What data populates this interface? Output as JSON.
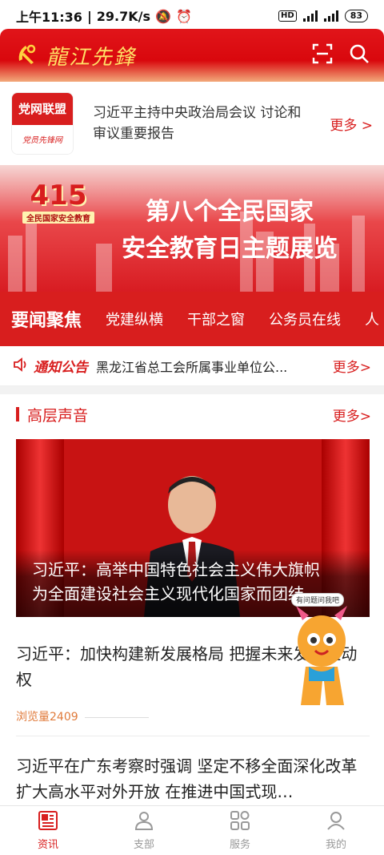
{
  "status_bar": {
    "time": "上午11:36",
    "net_speed": "29.7K/s",
    "network_hd": "HD",
    "network_4g_a": "4G",
    "network_4g_b": "4G",
    "battery": "83"
  },
  "header": {
    "app_title": "龍江先鋒",
    "icons": [
      "party-emblem-icon",
      "scan-icon",
      "search-icon"
    ]
  },
  "news_banner": {
    "logo_top": "党网联盟",
    "logo_bottom": "党员先锋网",
    "headline": "习近平主持中央政治局会议 讨论和审议重要报告",
    "more": "更多 >"
  },
  "hero_banner": {
    "badge_number": "415",
    "badge_caption": "全民国家安全教育",
    "title_line1": "第八个全民国家",
    "title_line2": "安全教育日主题展览"
  },
  "tabs": [
    "要闻聚焦",
    "党建纵横",
    "干部之窗",
    "公务员在线",
    "人"
  ],
  "notice": {
    "label": "通知公告",
    "text": "黑龙江省总工会所属事业单位公...",
    "more": "更多>"
  },
  "section": {
    "title": "高层声音",
    "more": "更多>"
  },
  "feature": {
    "caption_line1": "习近平：高举中国特色社会主义伟大旗帜",
    "caption_line2": "为全面建设社会主义现代化国家而团结..."
  },
  "mascot": {
    "bubble": "有问题问我吧"
  },
  "articles": [
    {
      "title": "习近平：加快构建新发展格局 把握未来发展主动权",
      "views": "浏览量2409"
    },
    {
      "title": "习近平在广东考察时强调 坚定不移全面深化改革扩大高水平对外开放 在推进中国式现…"
    }
  ],
  "bottom_nav": [
    {
      "label": "资讯",
      "icon": "news-icon",
      "active": true
    },
    {
      "label": "支部",
      "icon": "branch-icon",
      "active": false
    },
    {
      "label": "服务",
      "icon": "service-grid-icon",
      "active": false
    },
    {
      "label": "我的",
      "icon": "profile-icon",
      "active": false
    }
  ],
  "colors": {
    "brand_red": "#d81e1e",
    "accent_gold": "#ffe066",
    "views_orange": "#e07a3a"
  }
}
